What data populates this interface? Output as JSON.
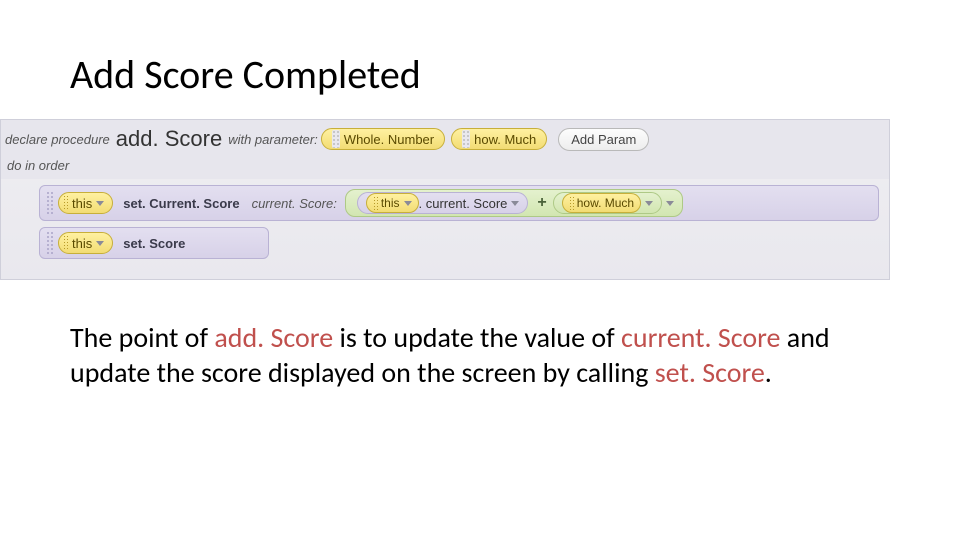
{
  "title": "Add Score Completed",
  "code": {
    "declare": "declare procedure",
    "procname": "add. Score",
    "withparam": "with parameter:",
    "paramType": "Whole. Number",
    "paramName": "how. Much",
    "addParam": "Add Param",
    "doin": "do in order",
    "this": "this",
    "method1": "set. Current. Score",
    "argLabel": "current. Score:",
    "innerThis": "this",
    "prop": ". current. Score",
    "operand": "how. Much",
    "method2": "set. Score"
  },
  "desc": {
    "t1": "The point of ",
    "r1": "add. Score",
    "t2": " is to update the value of ",
    "r2": "current. Score",
    "t3": " and update the score displayed on the screen by calling ",
    "r3": "set. Score",
    "t4": "."
  }
}
